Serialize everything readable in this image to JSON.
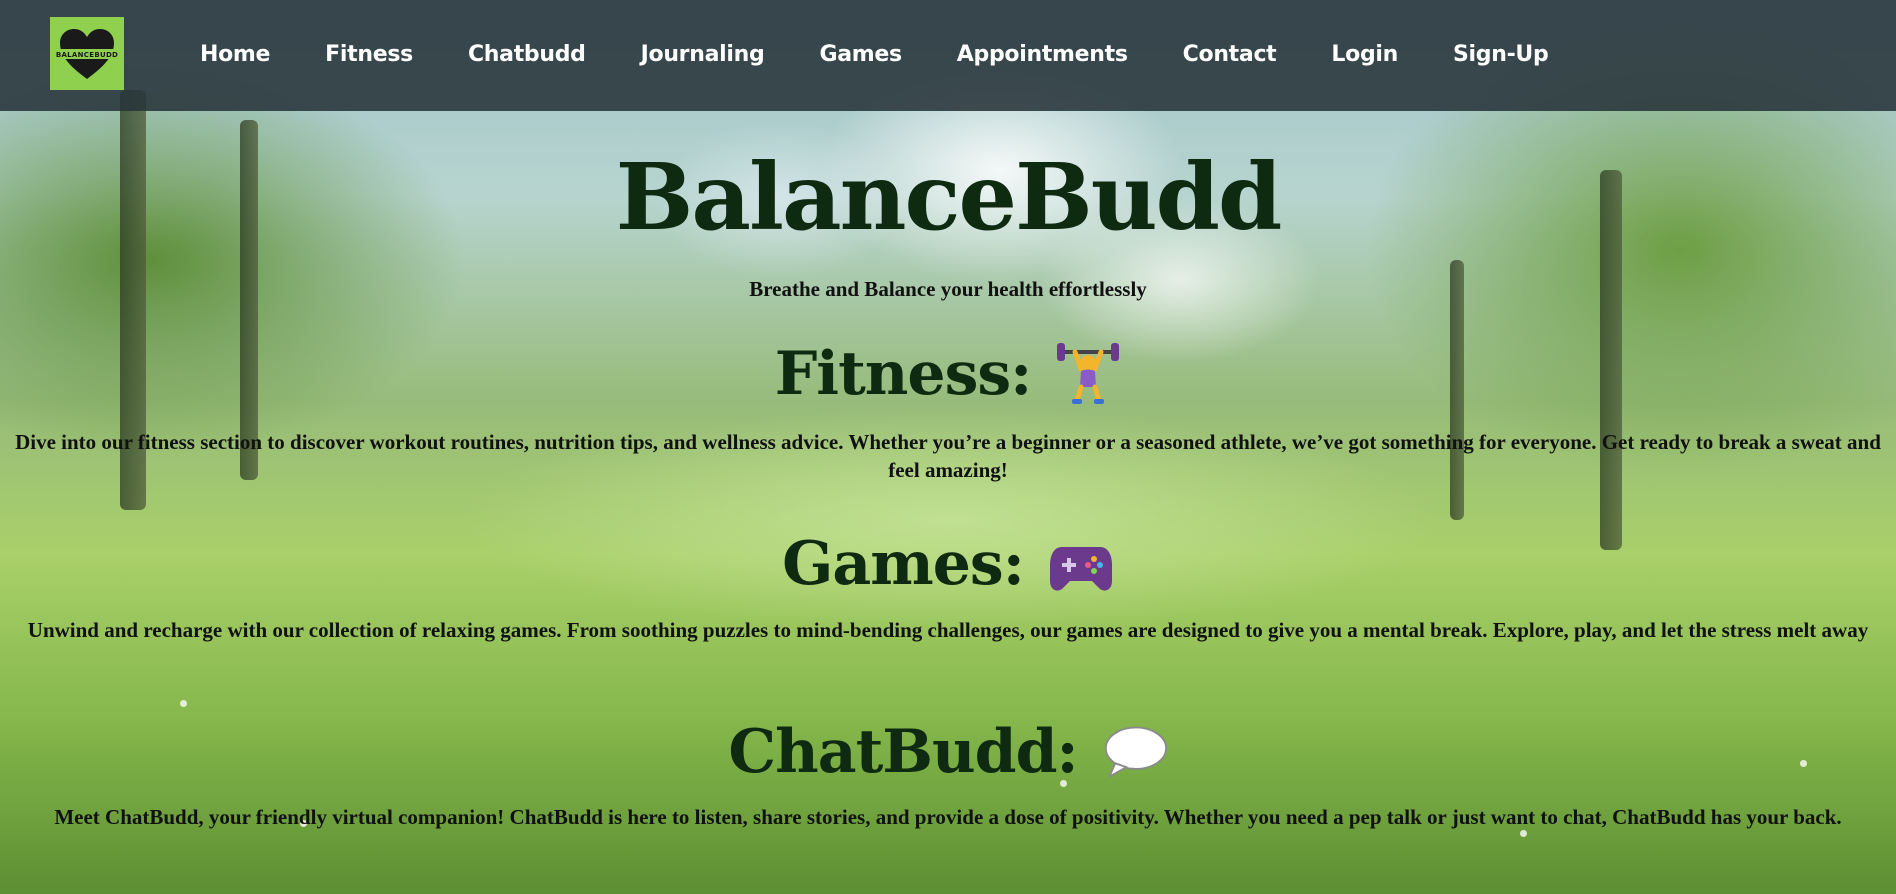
{
  "brand": {
    "logo_text": "BALANCEBUDD",
    "logo_color": "#8fd14f"
  },
  "nav": {
    "items": [
      {
        "label": "Home"
      },
      {
        "label": "Fitness"
      },
      {
        "label": "Chatbudd"
      },
      {
        "label": "Journaling"
      },
      {
        "label": "Games"
      },
      {
        "label": "Appointments"
      },
      {
        "label": "Contact"
      },
      {
        "label": "Login"
      },
      {
        "label": "Sign-Up"
      }
    ]
  },
  "hero": {
    "title": "BalanceBudd",
    "tagline": "Breathe and Balance your health effortlessly"
  },
  "sections": {
    "fitness": {
      "heading": "Fitness:",
      "icon": "weightlifter-icon",
      "text": "Dive into our fitness section to discover workout routines, nutrition tips, and wellness advice. Whether you’re a beginner or a seasoned athlete, we’ve got something for everyone. Get ready to break a sweat and feel amazing!"
    },
    "games": {
      "heading": "Games:",
      "icon": "game-controller-icon",
      "text": "Unwind and recharge with our collection of relaxing games. From soothing puzzles to mind-bending challenges, our games are designed to give you a mental break. Explore, play, and let the stress melt away"
    },
    "chatbudd": {
      "heading": "ChatBudd:",
      "icon": "speech-bubble-icon",
      "text": "Meet ChatBudd, your friendly virtual companion! ChatBudd is here to listen, share stories, and provide a dose of positivity. Whether you need a pep talk or just want to chat, ChatBudd has your back."
    }
  },
  "colors": {
    "navbar_bg": "#28343a",
    "heading_color": "#0e2a10",
    "controller_purple": "#6b3a8c"
  }
}
